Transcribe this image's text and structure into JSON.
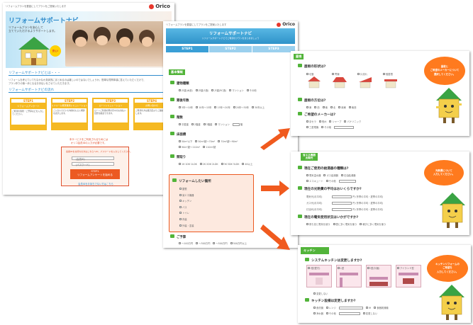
{
  "main": {
    "top_tagline": "リフォームプランを要望にしてプランをご提案いたします",
    "brand": "Orico",
    "hero_title": "リフォームサポートナビ",
    "hero_sub1": "リフォームプランを安心して",
    "hero_sub2": "立てていただけるようサポートします。",
    "anshin": "安心!",
    "section1_title": "リフォームサポートナビとは・・・",
    "section1_text1": "リフォームを考えていてもなかなか具体的にまとめるのは難しいのではないでしょうか。簡単な質問事項に答えていただくだけで、",
    "section1_text2": "プラン作りの第一歩となるお手伝いをさせていただきます。",
    "section2_title": "リフォームサポートナビの流れ",
    "steps": [
      {
        "label": "STEP1",
        "desc": "リフォームアンケート",
        "body": "ご希望の箇所・ご予算などを入力してください。"
      },
      {
        "label": "STEP2",
        "desc": "リフォーム概算費用シミュレーション",
        "body": "ご入力いただいた内容をもとに概算を表示します。"
      },
      {
        "label": "STEP3",
        "desc": "ローンシミュレーション",
        "body": "ローンご利用の際の月々のお支払い目安を確認できます。"
      },
      {
        "label": "STEP4",
        "desc": "お問い合わせ",
        "body": "ご希望の方は販売店よりご連絡いたします。"
      }
    ],
    "notice1": "本サービスをご利用されるためには",
    "notice2": "オリコ会員IDの入力が必要です。",
    "form_caption": "会員IDをお持ちの方はこちらへID、パスワードを入力してください。",
    "form_id_label": "(会員ID)",
    "form_pw_label": "(パスワード)",
    "start_button_line1": "STEP1",
    "start_button_line2": "リフォームアンケートを始める",
    "foot_note": "会員IDをお持ちでない方はこちら"
  },
  "form": {
    "top_tagline": "リフォームプランを要望にしてプランをご提案いたします",
    "brand": "Orico",
    "header": "リフォームサポートナビ",
    "header_sub": "リフォームサポートナビでご希望のプランをまとめましょう",
    "steps": [
      "STEP1",
      "STEP2",
      "STEP3"
    ],
    "section_title": "基本情報",
    "q1": "建物種類",
    "q1_opts": [
      "戸建(木造)",
      "戸建(S造)",
      "戸建(RC造)",
      "マンション",
      "その他"
    ],
    "q2": "築後年数",
    "q2_opts": [
      "5年〜10年",
      "10年〜15年",
      "15年〜20年",
      "20年〜30年",
      "30年以上"
    ],
    "q3": "階数",
    "q3_opts": [
      "平屋建",
      "2階建",
      "3階建",
      "マンション",
      "階"
    ],
    "q4": "床面積",
    "q4_opts": [
      "50m²以下",
      "50m²超〜70m²",
      "70m²超〜90m²",
      "90m²超〜110m²",
      "110m²超"
    ],
    "q5": "間取り",
    "q5_opts": [
      "1K·1DK·1LDK",
      "2K·2DK·2LDK",
      "3K·3DK·3LDK",
      "4K以上"
    ],
    "place_title": "リフォームしたい箇所",
    "places": [
      "屋根",
      "省エネ機器",
      "キッチン",
      "バス",
      "トイレ",
      "内装",
      "外装・塗装"
    ],
    "budget_title": "ご予算",
    "budget_opts": [
      "〜100万円",
      "〜300万円",
      "〜500万円",
      "500万円以上"
    ]
  },
  "roof": {
    "section": "屋根",
    "q1": "屋根の形状は?",
    "shapes": [
      "切妻",
      "寄棟",
      "片流れ",
      "陸屋根"
    ],
    "q2": "屋根の方位は?",
    "directions": [
      "東",
      "西",
      "南",
      "北",
      "南東",
      "南西"
    ],
    "q3": "ご希望のメーカーは?",
    "makers": [
      "京セラ",
      "長州",
      "シャープ",
      "パナソニック",
      "三菱電機",
      "その他"
    ],
    "bubble": "屋根と\nご希望のメーカーについて\n選択してください。"
  },
  "eco": {
    "section": "省エネ機器\n太陽光",
    "q1": "現在ご使用の給湯器の種類は?",
    "q1_opts": [
      "電気温水器",
      "ガス給湯器",
      "石油給湯器",
      "エコキュート",
      "その他"
    ],
    "q2": "現在の光熱費の平均はおいくらですか?",
    "rows": [
      "電気代(月平均)",
      "ガス代(月平均)",
      "灯油代(月平均)"
    ],
    "unit": "円",
    "note": "(冬季の平均・夏季の平均)",
    "q3": "現在の電気使用状況はいかがですか?",
    "q3_opts": [
      "夜も割と電気を使う",
      "昼に多く電気を使う",
      "朝夕に多く電気を使う"
    ],
    "bubble": "光熱費について\n入力してください。"
  },
  "kitchen": {
    "section": "キッチン",
    "q1": "システムキッチンは変更しますか?",
    "layouts": [
      "I型(壁付)",
      "L型",
      "I型(対面)",
      "アイランド型"
    ],
    "q1_none": "変更しない",
    "q2": "キッチン設備は変更しますか?",
    "q2_opts": [
      "食洗機",
      "レンジ",
      "IH",
      "食器乾燥機",
      "浄水器",
      "その他"
    ],
    "q2_none": "変更しない",
    "bubble": "キッチンリフォームの\nご希望を\n入力してください。"
  },
  "colors": {
    "green": "#52b43a",
    "orange": "#ff7a1e",
    "blue_header": "#3aa3d8",
    "red_box": "#e0502c"
  }
}
